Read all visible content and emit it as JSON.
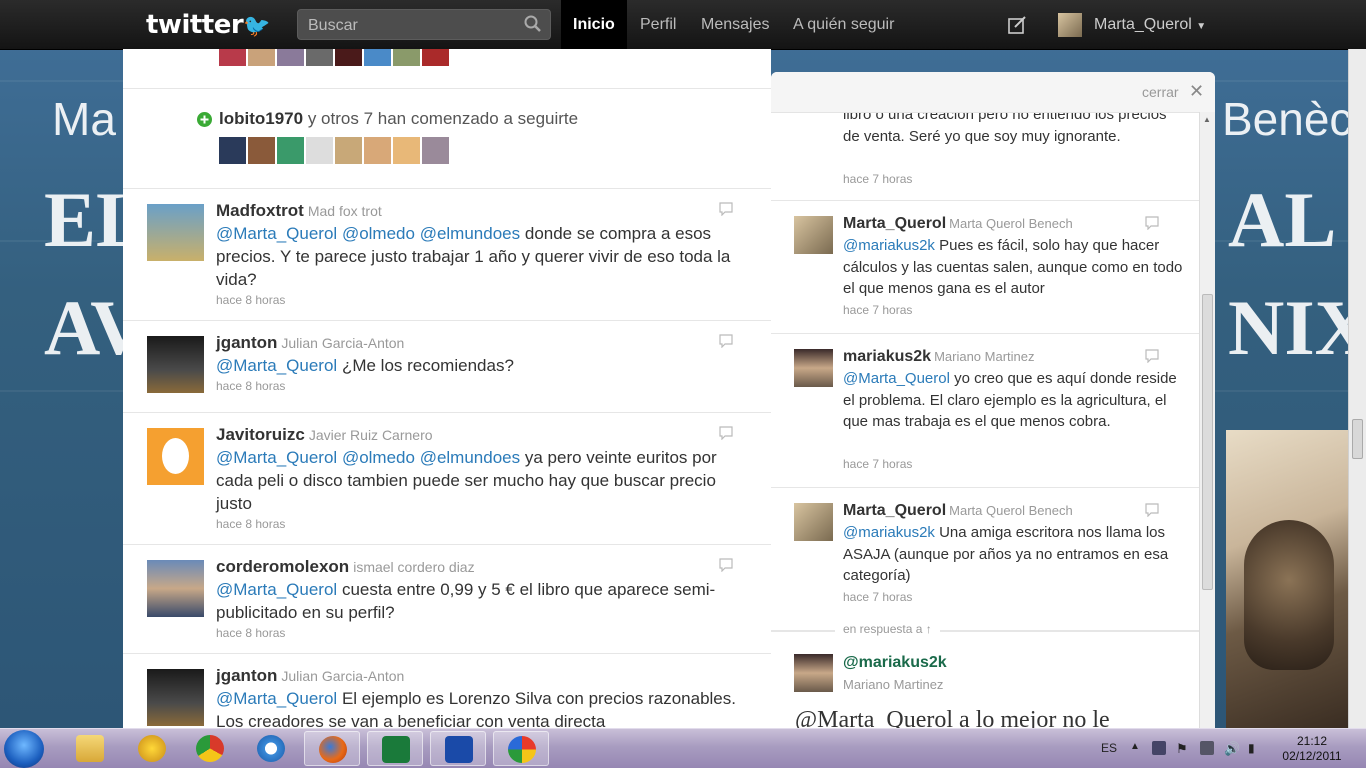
{
  "header": {
    "logo_text": "twitter",
    "search_placeholder": "Buscar",
    "nav": [
      "Inicio",
      "Perfil",
      "Mensajes",
      "A quién seguir"
    ],
    "active_nav": "Inicio",
    "username": "Marta_Querol"
  },
  "background": {
    "words": [
      "Ma",
      "Benèch",
      "EL",
      "AL",
      "AV",
      "NIX"
    ]
  },
  "stream": {
    "follow_notice": {
      "user": "lobito1970",
      "text": "y otros 7 han comenzado a seguirte"
    },
    "tweets": [
      {
        "user": "Madfoxtrot",
        "fullname": "Mad fox trot",
        "mentions": [
          "@Marta_Querol",
          "@olmedo",
          "@elmundoes"
        ],
        "text": "donde se compra a esos precios. Y te parece justo trabajar 1 año y querer vivir de eso toda la vida?",
        "time": "hace 8 horas"
      },
      {
        "user": "jganton",
        "fullname": "Julian Garcia-Anton",
        "mentions": [
          "@Marta_Querol"
        ],
        "text": "¿Me los recomiendas?",
        "time": "hace 8 horas"
      },
      {
        "user": "Javitoruizc",
        "fullname": "Javier Ruiz Carnero",
        "mentions": [
          "@Marta_Querol",
          "@olmedo",
          "@elmundoes"
        ],
        "text": "ya pero veinte euritos por cada peli o disco tambien puede ser mucho hay que buscar precio justo",
        "time": "hace 8 horas"
      },
      {
        "user": "corderomolexon",
        "fullname": "ismael cordero diaz",
        "mentions": [
          "@Marta_Querol"
        ],
        "text": "cuesta entre 0,99 y 5 € el libro que aparece semi-publicitado en su perfil?",
        "time": "hace 8 horas"
      },
      {
        "user": "jganton",
        "fullname": "Julian Garcia-Anton",
        "mentions": [
          "@Marta_Querol"
        ],
        "text": "El ejemplo es Lorenzo Silva con precios razonables. Los creadores se van a beneficiar con venta directa",
        "time": ""
      }
    ]
  },
  "panel": {
    "close_label": "cerrar",
    "partial_text": "libro o una creación pero no entiendo los precios de venta. Seré yo que soy muy ignorante.",
    "partial_time": "hace 7 horas",
    "tweets": [
      {
        "user": "Marta_Querol",
        "fullname": "Marta Querol Benech",
        "mention": "@mariakus2k",
        "text": "Pues es fácil, solo hay que hacer cálculos y las cuentas salen, aunque como en todo el que menos gana es el autor",
        "time": "hace 7 horas"
      },
      {
        "user": "mariakus2k",
        "fullname": "Mariano Martinez",
        "mention": "@Marta_Querol",
        "text": "yo creo que es aquí donde reside el problema. El claro ejemplo es la agricultura, el que mas trabaja es el que menos cobra.",
        "time": "hace 7 horas"
      },
      {
        "user": "Marta_Querol",
        "fullname": "Marta Querol Benech",
        "mention": "@mariakus2k",
        "text": "Una amiga escritora nos llama los ASAJA (aunque por años ya no entramos en esa categoría)",
        "time": "hace 7 horas"
      }
    ],
    "in_reply_label": "en respuesta a ↑",
    "main_tweet": {
      "user": "@mariakus2k",
      "fullname": "Mariano Martinez",
      "text_partial": "@Marta_Querol a lo mejor no le"
    }
  },
  "taskbar": {
    "lang": "ES",
    "time": "21:12",
    "date": "02/12/2011"
  },
  "colors": {
    "link": "#2b7bb9",
    "topbar": "#1a1a1a",
    "follow_green": "#3aaa35"
  }
}
